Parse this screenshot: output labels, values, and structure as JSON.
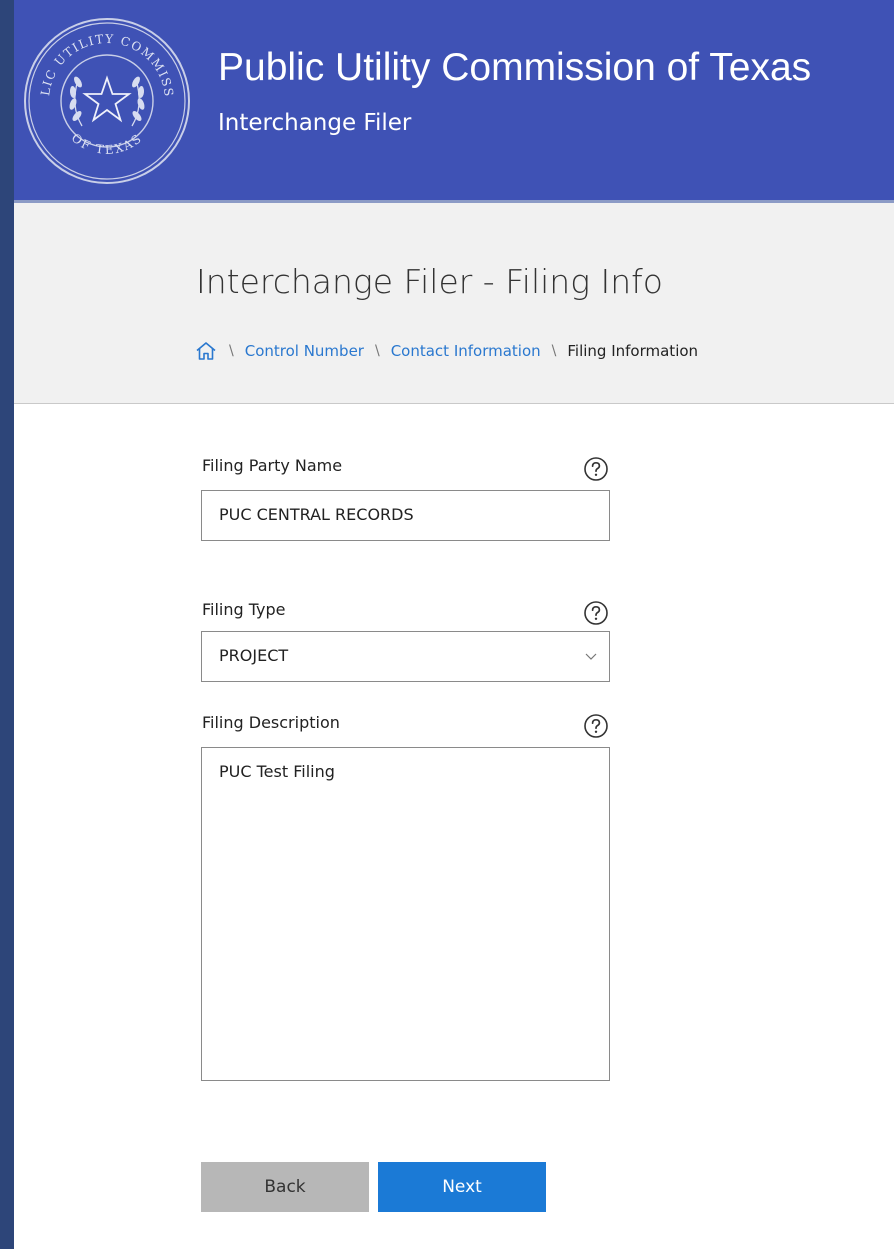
{
  "header": {
    "title": "Public Utility Commission of Texas",
    "subtitle": "Interchange Filer",
    "seal": {
      "icon": "texas-seal-icon",
      "text_top": "PUBLIC UTILITY COMMISSION",
      "text_bottom": "OF TEXAS"
    }
  },
  "page": {
    "title": "Interchange Filer - Filing Info"
  },
  "breadcrumb": {
    "home_icon": "home-icon",
    "separator": "\\",
    "items": [
      {
        "label": "Control Number"
      },
      {
        "label": "Contact Information"
      },
      {
        "label": "Filing Information"
      }
    ]
  },
  "form": {
    "party_name": {
      "label": "Filing Party Name",
      "value": "PUC CENTRAL RECORDS"
    },
    "filing_type": {
      "label": "Filing Type",
      "value": "PROJECT"
    },
    "description": {
      "label": "Filing Description",
      "value": "PUC Test Filing"
    }
  },
  "buttons": {
    "back": "Back",
    "next": "Next"
  },
  "colors": {
    "header_bg": "#3f52b5",
    "link": "#2a78cf",
    "next_button": "#1b7ad6",
    "back_button": "#b7b7b7",
    "band_bg": "#f1f1f1",
    "outer_bg": "#2d4579"
  }
}
